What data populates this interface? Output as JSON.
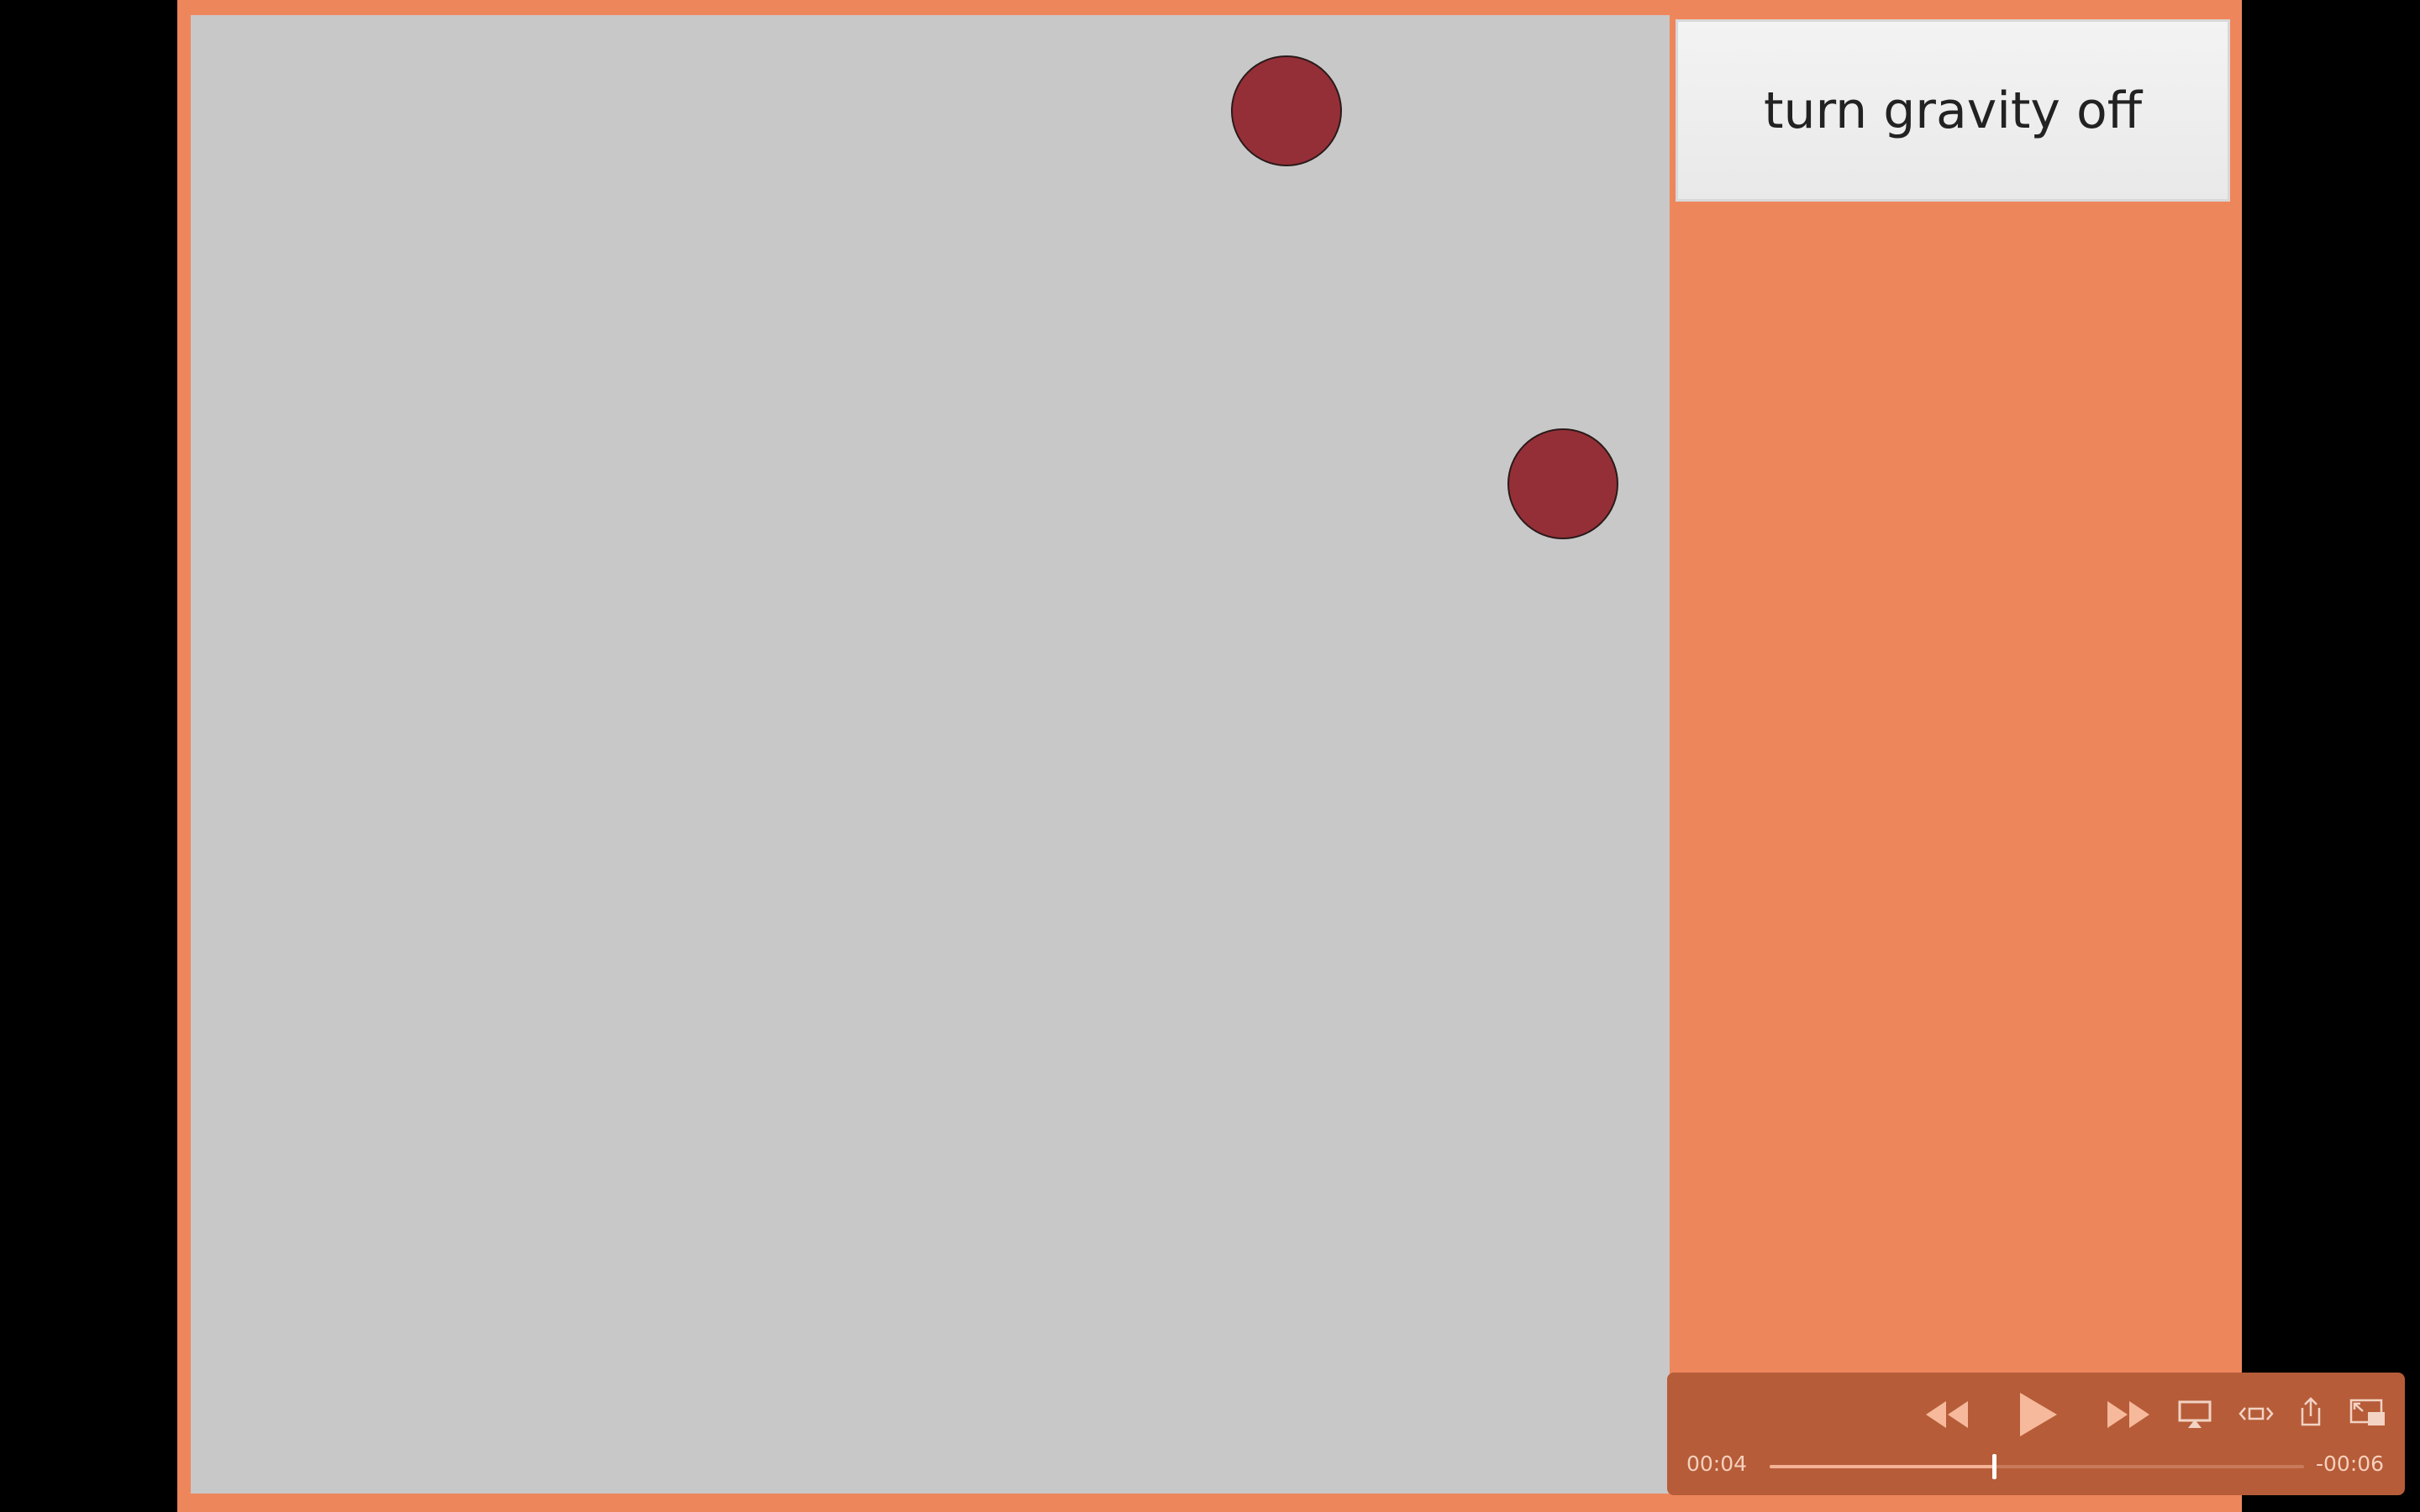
{
  "app": {
    "gravity_button_label": "turn gravity off"
  },
  "simulation": {
    "ball_count": 2,
    "ball_color": "#952f37",
    "canvas_color": "#c8c8c8",
    "frame_color": "#ee865c"
  },
  "player": {
    "elapsed": "00:04",
    "remaining": "-00:06",
    "progress": 0.42,
    "icons": [
      "rewind-icon",
      "play-icon",
      "fast-forward-icon",
      "airplay-icon",
      "fit-screen-icon",
      "share-icon",
      "picture-in-picture-icon"
    ]
  }
}
